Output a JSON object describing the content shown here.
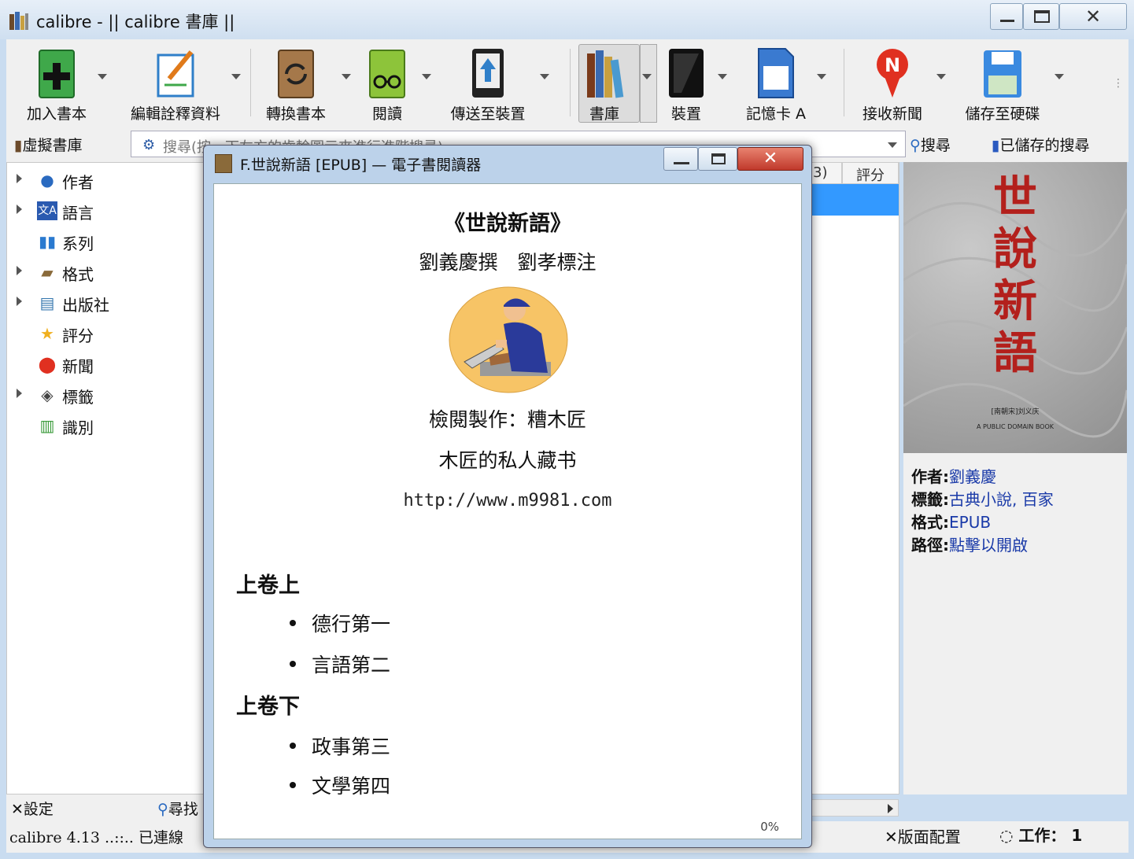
{
  "window": {
    "title": "calibre - || calibre 書庫 ||"
  },
  "toolbar": {
    "items": [
      {
        "label": "加入書本",
        "icon": "add-book-icon"
      },
      {
        "label": "編輯詮釋資料",
        "icon": "edit-metadata-icon"
      },
      {
        "label": "轉換書本",
        "icon": "convert-icon"
      },
      {
        "label": "閱讀",
        "icon": "read-icon"
      },
      {
        "label": "傳送至裝置",
        "icon": "send-to-device-icon"
      },
      {
        "label": "書庫",
        "icon": "library-icon"
      },
      {
        "label": "裝置",
        "icon": "device-icon"
      },
      {
        "label": "記憶卡 A",
        "icon": "memory-card-icon"
      },
      {
        "label": "接收新聞",
        "icon": "fetch-news-icon"
      },
      {
        "label": "儲存至硬碟",
        "icon": "save-to-disk-icon"
      }
    ]
  },
  "search": {
    "virtual_library": "虛擬書庫",
    "placeholder": "搜尋(按一下左方的齒輪圖示來進行進階搜尋)",
    "search_button": "搜尋",
    "saved_searches": "已儲存的搜尋"
  },
  "tag_browser": {
    "items": [
      {
        "label": "作者",
        "icon": "person-icon",
        "expandable": true
      },
      {
        "label": "語言",
        "icon": "language-icon",
        "expandable": true
      },
      {
        "label": "系列",
        "icon": "series-icon",
        "expandable": false
      },
      {
        "label": "格式",
        "icon": "format-icon",
        "expandable": true
      },
      {
        "label": "出版社",
        "icon": "publisher-icon",
        "expandable": true
      },
      {
        "label": "評分",
        "icon": "star-icon",
        "expandable": false
      },
      {
        "label": "新聞",
        "icon": "news-icon",
        "expandable": false
      },
      {
        "label": "標籤",
        "icon": "tag-icon",
        "expandable": true
      },
      {
        "label": "識別",
        "icon": "barcode-icon",
        "expandable": false
      }
    ],
    "settings": "設定",
    "find": "尋找"
  },
  "book_list": {
    "column_partial": "3)",
    "column_rating": "評分"
  },
  "book_details": {
    "cover_title": "世說新語",
    "cover_line1": "[南朝宋]刘义庆",
    "cover_line2": "A PUBLIC DOMAIN BOOK",
    "rows": [
      {
        "key": "作者:",
        "value": "劉義慶"
      },
      {
        "key": "標籤:",
        "value": "古典小說, 百家"
      },
      {
        "key": "格式:",
        "value": "EPUB"
      },
      {
        "key": "路徑:",
        "value": "點擊以開啟"
      }
    ]
  },
  "status_bar": {
    "text": "calibre 4.13 ..::.. 已連線",
    "layout": "版面配置",
    "jobs": "工作： 1"
  },
  "viewer": {
    "title": "F.世說新語 [EPUB] — 電子書閱讀器",
    "book_title": "《世說新語》",
    "authors": "劉義慶撰　劉孝標注",
    "producer": "檢閱製作：糟木匠",
    "collection": "木匠的私人藏书",
    "url": "http://www.m9981.com",
    "volumes": [
      {
        "heading": "上卷上",
        "chapters": [
          "德行第一",
          "言語第二"
        ]
      },
      {
        "heading": "上卷下",
        "chapters": [
          "政事第三",
          "文學第四"
        ]
      }
    ],
    "progress": "0%"
  }
}
